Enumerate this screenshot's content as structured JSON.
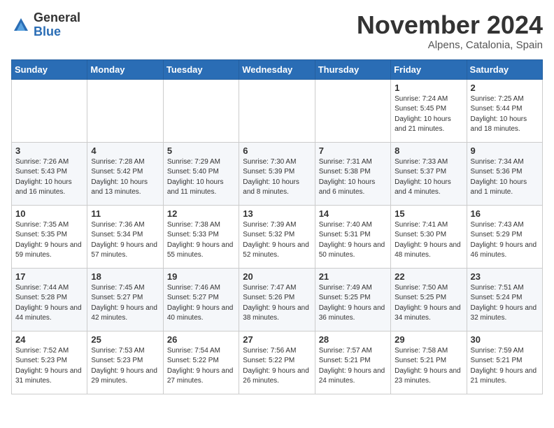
{
  "logo": {
    "general": "General",
    "blue": "Blue"
  },
  "title": "November 2024",
  "subtitle": "Alpens, Catalonia, Spain",
  "weekdays": [
    "Sunday",
    "Monday",
    "Tuesday",
    "Wednesday",
    "Thursday",
    "Friday",
    "Saturday"
  ],
  "weeks": [
    [
      {
        "day": "",
        "info": ""
      },
      {
        "day": "",
        "info": ""
      },
      {
        "day": "",
        "info": ""
      },
      {
        "day": "",
        "info": ""
      },
      {
        "day": "",
        "info": ""
      },
      {
        "day": "1",
        "info": "Sunrise: 7:24 AM\nSunset: 5:45 PM\nDaylight: 10 hours and 21 minutes."
      },
      {
        "day": "2",
        "info": "Sunrise: 7:25 AM\nSunset: 5:44 PM\nDaylight: 10 hours and 18 minutes."
      }
    ],
    [
      {
        "day": "3",
        "info": "Sunrise: 7:26 AM\nSunset: 5:43 PM\nDaylight: 10 hours and 16 minutes."
      },
      {
        "day": "4",
        "info": "Sunrise: 7:28 AM\nSunset: 5:42 PM\nDaylight: 10 hours and 13 minutes."
      },
      {
        "day": "5",
        "info": "Sunrise: 7:29 AM\nSunset: 5:40 PM\nDaylight: 10 hours and 11 minutes."
      },
      {
        "day": "6",
        "info": "Sunrise: 7:30 AM\nSunset: 5:39 PM\nDaylight: 10 hours and 8 minutes."
      },
      {
        "day": "7",
        "info": "Sunrise: 7:31 AM\nSunset: 5:38 PM\nDaylight: 10 hours and 6 minutes."
      },
      {
        "day": "8",
        "info": "Sunrise: 7:33 AM\nSunset: 5:37 PM\nDaylight: 10 hours and 4 minutes."
      },
      {
        "day": "9",
        "info": "Sunrise: 7:34 AM\nSunset: 5:36 PM\nDaylight: 10 hours and 1 minute."
      }
    ],
    [
      {
        "day": "10",
        "info": "Sunrise: 7:35 AM\nSunset: 5:35 PM\nDaylight: 9 hours and 59 minutes."
      },
      {
        "day": "11",
        "info": "Sunrise: 7:36 AM\nSunset: 5:34 PM\nDaylight: 9 hours and 57 minutes."
      },
      {
        "day": "12",
        "info": "Sunrise: 7:38 AM\nSunset: 5:33 PM\nDaylight: 9 hours and 55 minutes."
      },
      {
        "day": "13",
        "info": "Sunrise: 7:39 AM\nSunset: 5:32 PM\nDaylight: 9 hours and 52 minutes."
      },
      {
        "day": "14",
        "info": "Sunrise: 7:40 AM\nSunset: 5:31 PM\nDaylight: 9 hours and 50 minutes."
      },
      {
        "day": "15",
        "info": "Sunrise: 7:41 AM\nSunset: 5:30 PM\nDaylight: 9 hours and 48 minutes."
      },
      {
        "day": "16",
        "info": "Sunrise: 7:43 AM\nSunset: 5:29 PM\nDaylight: 9 hours and 46 minutes."
      }
    ],
    [
      {
        "day": "17",
        "info": "Sunrise: 7:44 AM\nSunset: 5:28 PM\nDaylight: 9 hours and 44 minutes."
      },
      {
        "day": "18",
        "info": "Sunrise: 7:45 AM\nSunset: 5:27 PM\nDaylight: 9 hours and 42 minutes."
      },
      {
        "day": "19",
        "info": "Sunrise: 7:46 AM\nSunset: 5:27 PM\nDaylight: 9 hours and 40 minutes."
      },
      {
        "day": "20",
        "info": "Sunrise: 7:47 AM\nSunset: 5:26 PM\nDaylight: 9 hours and 38 minutes."
      },
      {
        "day": "21",
        "info": "Sunrise: 7:49 AM\nSunset: 5:25 PM\nDaylight: 9 hours and 36 minutes."
      },
      {
        "day": "22",
        "info": "Sunrise: 7:50 AM\nSunset: 5:25 PM\nDaylight: 9 hours and 34 minutes."
      },
      {
        "day": "23",
        "info": "Sunrise: 7:51 AM\nSunset: 5:24 PM\nDaylight: 9 hours and 32 minutes."
      }
    ],
    [
      {
        "day": "24",
        "info": "Sunrise: 7:52 AM\nSunset: 5:23 PM\nDaylight: 9 hours and 31 minutes."
      },
      {
        "day": "25",
        "info": "Sunrise: 7:53 AM\nSunset: 5:23 PM\nDaylight: 9 hours and 29 minutes."
      },
      {
        "day": "26",
        "info": "Sunrise: 7:54 AM\nSunset: 5:22 PM\nDaylight: 9 hours and 27 minutes."
      },
      {
        "day": "27",
        "info": "Sunrise: 7:56 AM\nSunset: 5:22 PM\nDaylight: 9 hours and 26 minutes."
      },
      {
        "day": "28",
        "info": "Sunrise: 7:57 AM\nSunset: 5:21 PM\nDaylight: 9 hours and 24 minutes."
      },
      {
        "day": "29",
        "info": "Sunrise: 7:58 AM\nSunset: 5:21 PM\nDaylight: 9 hours and 23 minutes."
      },
      {
        "day": "30",
        "info": "Sunrise: 7:59 AM\nSunset: 5:21 PM\nDaylight: 9 hours and 21 minutes."
      }
    ]
  ]
}
